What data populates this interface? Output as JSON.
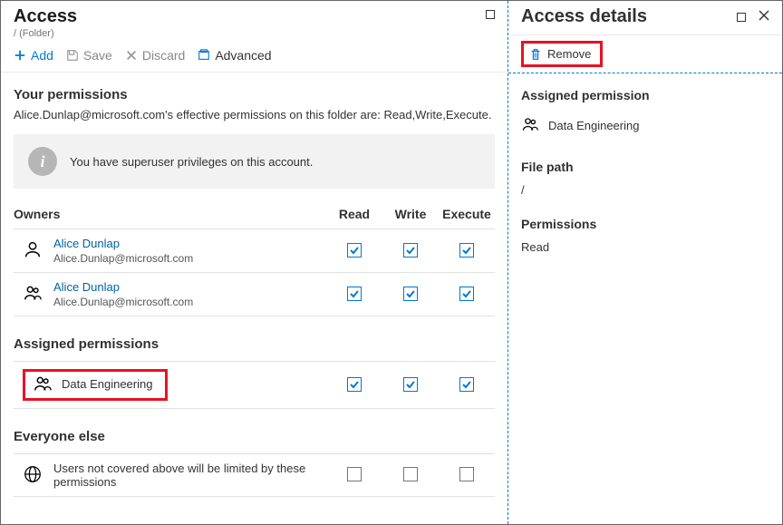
{
  "main": {
    "title": "Access",
    "subpath": "/ (Folder)",
    "toolbar": {
      "add": "Add",
      "save": "Save",
      "discard": "Discard",
      "advanced": "Advanced"
    },
    "your_permissions": {
      "heading": "Your permissions",
      "description": "Alice.Dunlap@microsoft.com's effective permissions on this folder are: Read,Write,Execute.",
      "banner": "You have superuser privileges on this account."
    },
    "columns": {
      "owners": "Owners",
      "read": "Read",
      "write": "Write",
      "execute": "Execute"
    },
    "owners": [
      {
        "name": "Alice Dunlap",
        "email": "Alice.Dunlap@microsoft.com",
        "read": true,
        "write": true,
        "execute": true,
        "type": "user"
      },
      {
        "name": "Alice Dunlap",
        "email": "Alice.Dunlap@microsoft.com",
        "read": true,
        "write": true,
        "execute": true,
        "type": "group"
      }
    ],
    "assigned": {
      "heading": "Assigned permissions",
      "items": [
        {
          "name": "Data Engineering",
          "read": true,
          "write": true,
          "execute": true,
          "highlighted": true
        }
      ]
    },
    "everyone": {
      "heading": "Everyone else",
      "text": "Users not covered above will be limited by these permissions",
      "read": false,
      "write": false,
      "execute": false
    }
  },
  "details": {
    "title": "Access details",
    "remove": "Remove",
    "assigned_heading": "Assigned permission",
    "assigned_name": "Data Engineering",
    "filepath_heading": "File path",
    "filepath_value": "/",
    "permissions_heading": "Permissions",
    "permissions_value": "Read"
  }
}
